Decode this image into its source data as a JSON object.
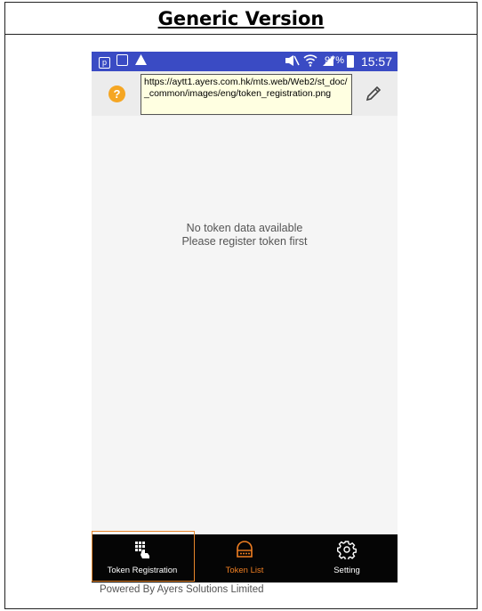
{
  "document": {
    "title": "Generic Version"
  },
  "statusbar": {
    "battery_percent": "97%",
    "time": "15:57"
  },
  "toolbar": {
    "tooltip_url": "https://aytt1.ayers.com.hk/mts.web/Web2/st_doc/_common/images/eng/token_registration.png",
    "help_symbol": "?"
  },
  "main": {
    "empty_line1": "No token data available",
    "empty_line2": "Please register token first"
  },
  "nav": {
    "items": [
      {
        "label": "Token Registration",
        "color": "#ffffff"
      },
      {
        "label": "Token List",
        "color": "#f07f22"
      },
      {
        "label": "Setting",
        "color": "#ffffff"
      }
    ]
  },
  "footer": {
    "powered_by": "Powered By Ayers Solutions Limited"
  },
  "colors": {
    "statusbar": "#3a4bc4",
    "accent": "#f07f22",
    "help": "#f5a623"
  }
}
